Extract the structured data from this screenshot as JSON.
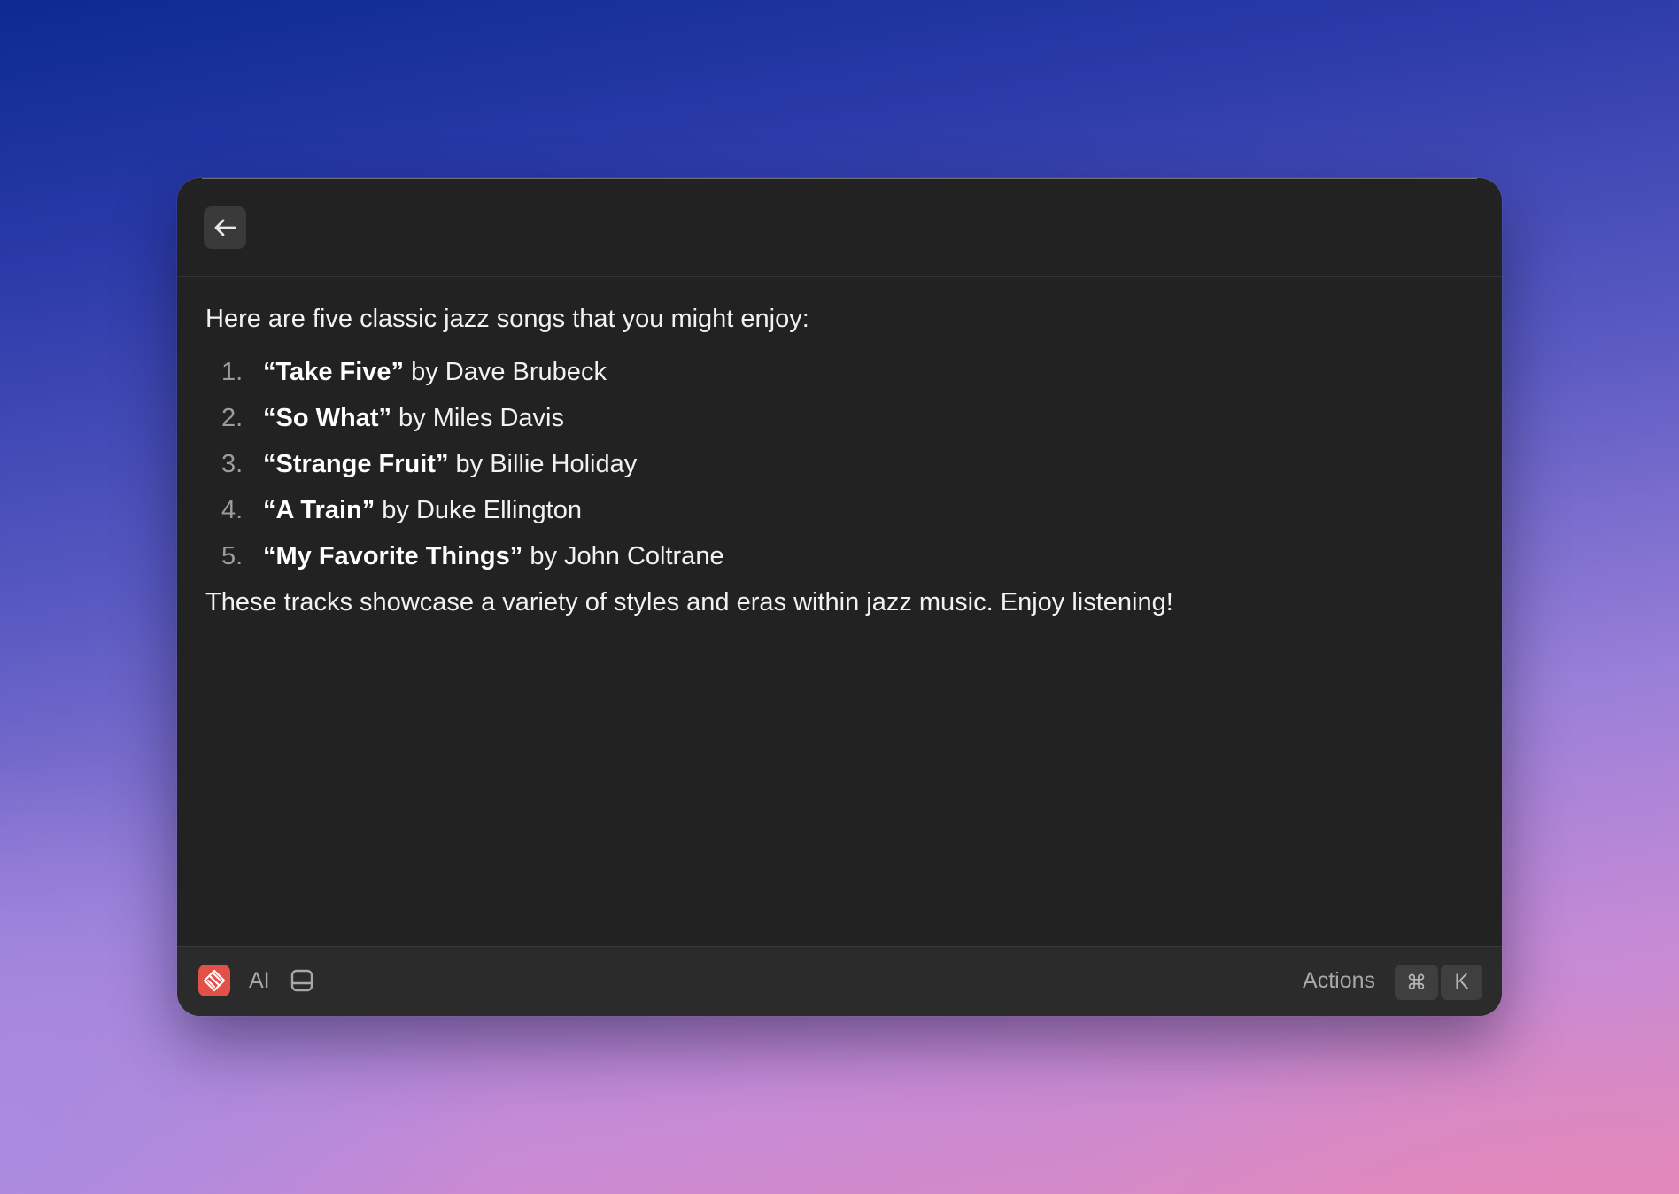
{
  "header": {
    "back_icon": "arrow-left-icon"
  },
  "response": {
    "intro": "Here are five classic jazz songs that you might enjoy:",
    "songs": [
      {
        "number": "1.",
        "title": "“Take Five”",
        "by": " by ",
        "artist": "Dave Brubeck"
      },
      {
        "number": "2.",
        "title": "“So What”",
        "by": " by ",
        "artist": "Miles Davis"
      },
      {
        "number": "3.",
        "title": "“Strange Fruit”",
        "by": " by ",
        "artist": "Billie Holiday"
      },
      {
        "number": "4.",
        "title": "“A Train”",
        "by": " by ",
        "artist": "Duke Ellington"
      },
      {
        "number": "5.",
        "title": "“My Favorite Things”",
        "by": " by ",
        "artist": "John Coltrane"
      }
    ],
    "outro": "These tracks showcase a variety of styles and eras within jazz music. Enjoy listening!"
  },
  "footer": {
    "app_icon": "raycast-icon",
    "ai_label": "AI",
    "panel_icon": "panel-icon",
    "actions_label": "Actions",
    "shortcut_keys": [
      "⌘",
      "K"
    ]
  },
  "colors": {
    "window_bg": "#222222",
    "footer_bg": "#2b2b2b",
    "app_icon_red": "#e2504a",
    "text": "#f2f2f2",
    "muted_text": "#a8a8a8"
  }
}
